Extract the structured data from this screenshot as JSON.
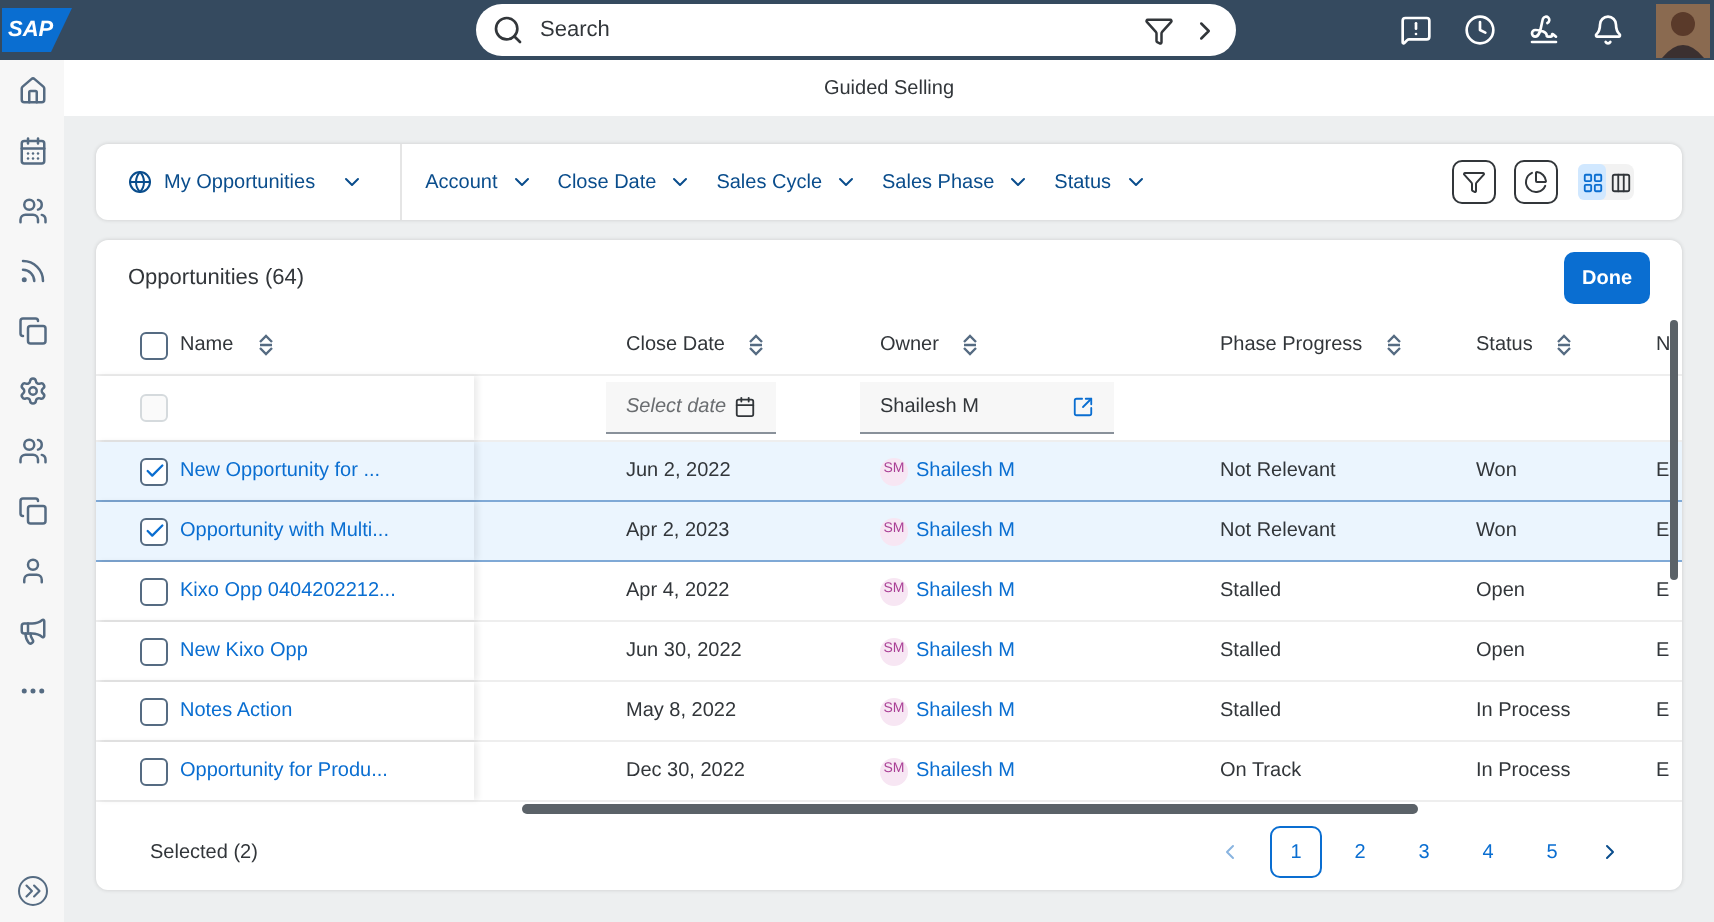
{
  "shell": {
    "logo": "SAP",
    "search": {
      "placeholder": "Search"
    }
  },
  "page": {
    "title": "Guided Selling"
  },
  "filter_bar": {
    "view": "My Opportunities",
    "filters": [
      "Account",
      "Close Date",
      "Sales Cycle",
      "Sales Phase",
      "Status"
    ],
    "view_modes": [
      {
        "kind": "table",
        "selected": true
      },
      {
        "kind": "chart",
        "selected": false
      }
    ]
  },
  "table": {
    "title": "Opportunities (64)",
    "done_button": "Done",
    "select_all": {
      "checked": false
    },
    "columns": [
      "Name",
      "Close Date",
      "Owner",
      "Phase Progress",
      "Status",
      "N"
    ],
    "filter_row": {
      "checkbox_disabled": true,
      "close_date_placeholder": "Select date",
      "owner_value": "Shailesh M"
    },
    "rows": [
      {
        "selected": true,
        "name": "New Opportunity for ...",
        "close_date": "Jun 2, 2022",
        "owner_initials": "SM",
        "owner": "Shailesh M",
        "phase_progress": "Not Relevant",
        "status": "Won",
        "column_6": "E"
      },
      {
        "selected": true,
        "name": "Opportunity with Multi...",
        "close_date": "Apr 2, 2023",
        "owner_initials": "SM",
        "owner": "Shailesh M",
        "phase_progress": "Not Relevant",
        "status": "Won",
        "column_6": "E"
      },
      {
        "selected": false,
        "name": "Kixo Opp 0404202212...",
        "close_date": "Apr 4, 2022",
        "owner_initials": "SM",
        "owner": "Shailesh M",
        "phase_progress": "Stalled",
        "status": "Open",
        "column_6": "E"
      },
      {
        "selected": false,
        "name": "New Kixo Opp",
        "close_date": "Jun 30, 2022",
        "owner_initials": "SM",
        "owner": "Shailesh M",
        "phase_progress": "Stalled",
        "status": "Open",
        "column_6": "E"
      },
      {
        "selected": false,
        "name": "Notes Action",
        "close_date": "May 8, 2022",
        "owner_initials": "SM",
        "owner": "Shailesh M",
        "phase_progress": "Stalled",
        "status": "In Process",
        "column_6": "E"
      },
      {
        "selected": false,
        "name": "Opportunity for Produ...",
        "close_date": "Dec 30, 2022",
        "owner_initials": "SM",
        "owner": "Shailesh M",
        "phase_progress": "On Track",
        "status": "In Process",
        "column_6": "E"
      }
    ],
    "footer": {
      "selected_count": "Selected (2)",
      "pages": [
        {
          "label": "1",
          "selected": true
        },
        {
          "label": "2",
          "selected": false
        },
        {
          "label": "3",
          "selected": false
        },
        {
          "label": "4",
          "selected": false
        },
        {
          "label": "5",
          "selected": false
        }
      ]
    }
  }
}
